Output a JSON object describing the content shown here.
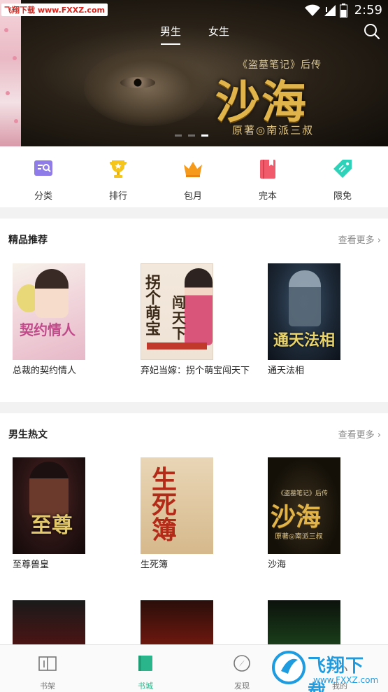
{
  "status_bar": {
    "time": "2:59",
    "watermark": "飞翔下载 www.FXXZ.com"
  },
  "top_tabs": [
    {
      "label": "男生",
      "active": true
    },
    {
      "label": "女生",
      "active": false
    }
  ],
  "banner": {
    "subtitle": "《盗墓笔记》后传",
    "title": "沙海",
    "author": "原著◎南派三叔",
    "dots": 3,
    "active_dot": 2
  },
  "categories": [
    {
      "label": "分类",
      "icon": "category-icon",
      "color": "#8f7ce8"
    },
    {
      "label": "排行",
      "icon": "trophy-icon",
      "color": "#f5c51b"
    },
    {
      "label": "包月",
      "icon": "crown-icon",
      "color": "#f59a1b"
    },
    {
      "label": "完本",
      "icon": "book-icon",
      "color": "#f05a6a"
    },
    {
      "label": "限免",
      "icon": "tag-icon",
      "color": "#2fd2b8"
    }
  ],
  "sections": [
    {
      "title": "精品推荐",
      "more": "查看更多",
      "books": [
        {
          "name": "总裁的契约情人",
          "cover_title": "契约情人"
        },
        {
          "name": "弃妃当嫁：拐个萌宝闯天下",
          "cover_title": "拐个萌宝",
          "cover_title2": "闯天下"
        },
        {
          "name": "通天法相",
          "cover_title": "通天法相"
        }
      ]
    },
    {
      "title": "男生热文",
      "more": "查看更多",
      "books": [
        {
          "name": "至尊兽皇",
          "cover_title": "至尊"
        },
        {
          "name": "生死簿",
          "cover_title": "生死簿"
        },
        {
          "name": "沙海",
          "cover_title": "沙海",
          "cover_sub": "《盗墓笔记》后传",
          "cover_author": "原著◎南派三叔"
        }
      ]
    }
  ],
  "bottom_nav": [
    {
      "label": "书架",
      "icon": "bookshelf-icon",
      "active": false
    },
    {
      "label": "书城",
      "icon": "bookstore-icon",
      "active": true
    },
    {
      "label": "发现",
      "icon": "compass-icon",
      "active": false
    },
    {
      "label": "我的",
      "icon": "profile-icon",
      "active": false
    }
  ],
  "watermark": {
    "text": "飞翔下载",
    "url": "www.FXXZ.com"
  },
  "colors": {
    "accent": "#2bb58a",
    "watermark": "#1f9be0"
  }
}
